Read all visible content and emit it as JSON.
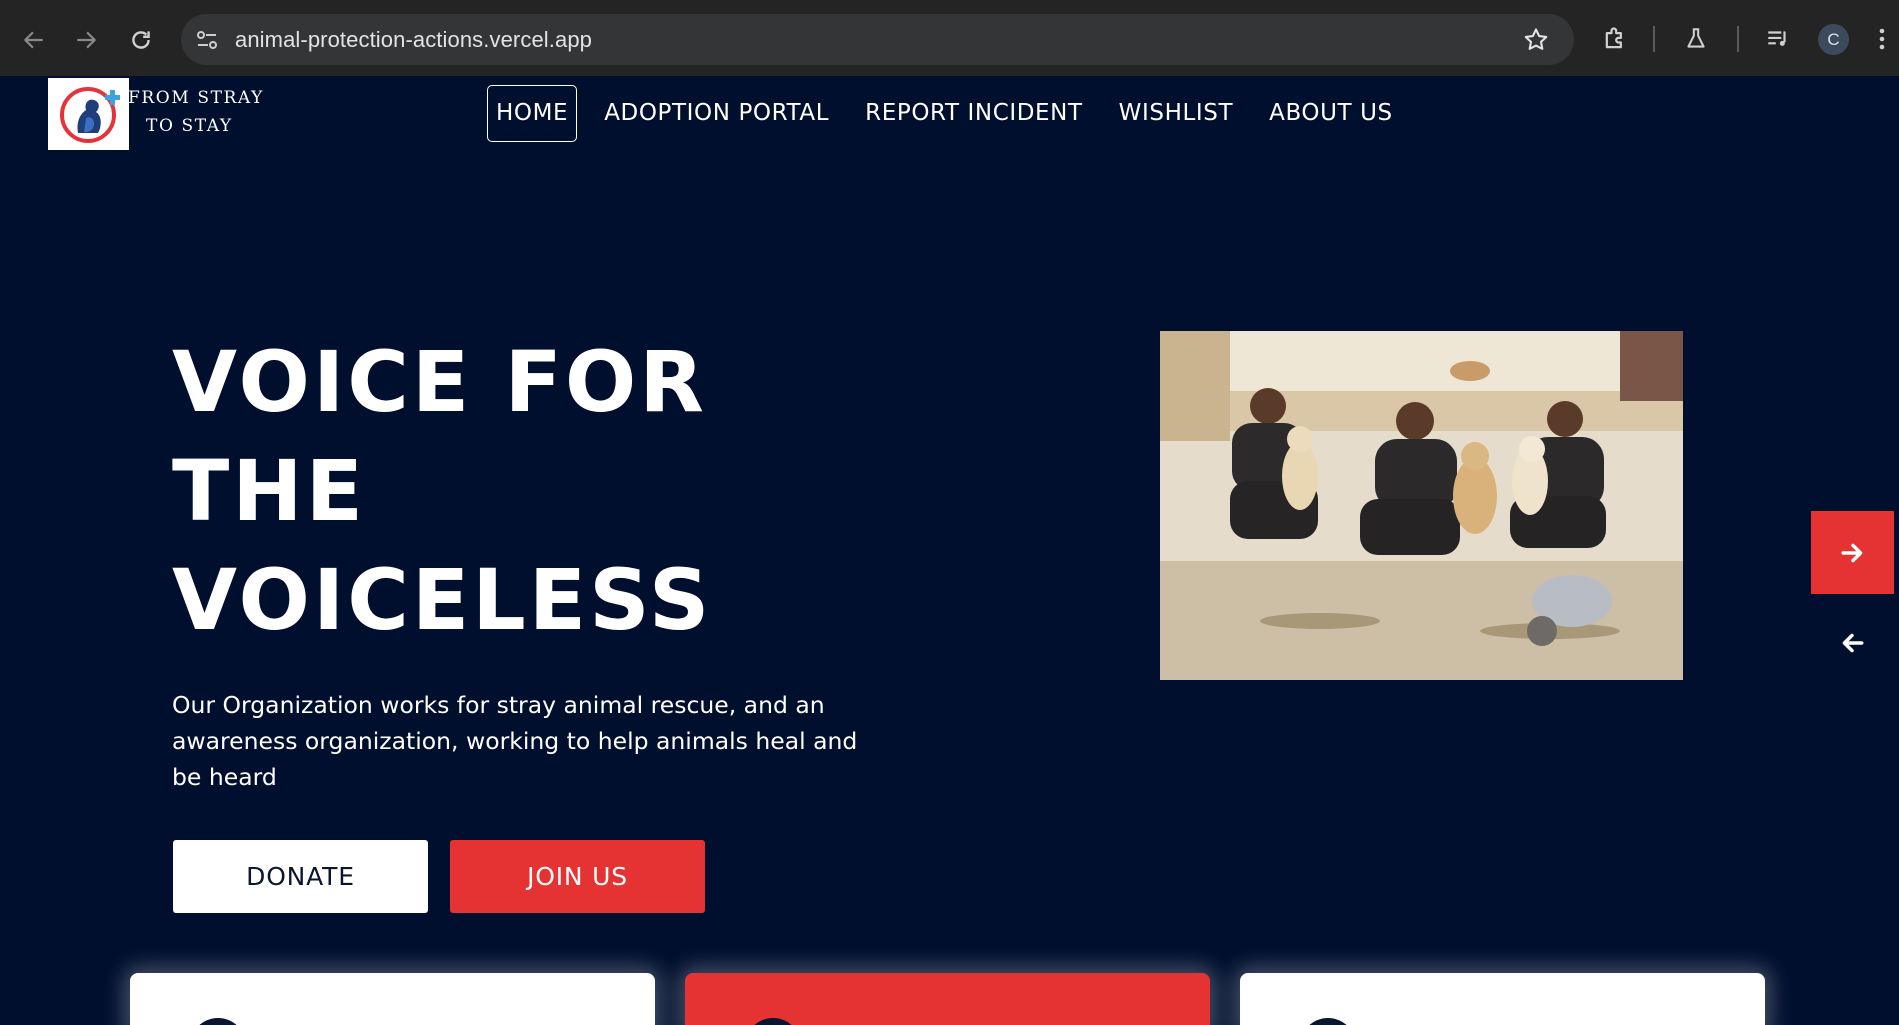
{
  "browser": {
    "url": "animal-protection-actions.vercel.app",
    "profile_initial": "C",
    "icons": [
      "back-arrow-icon",
      "forward-arrow-icon",
      "reload-icon",
      "site-settings-icon",
      "bookmark-star-icon",
      "extensions-icon",
      "labs-flask-icon",
      "media-queue-icon"
    ]
  },
  "site": {
    "logo_line1": "From Stray",
    "logo_line2": "To Stay",
    "nav": [
      {
        "label": "HOME",
        "active": true
      },
      {
        "label": "ADOPTION PORTAL",
        "active": false
      },
      {
        "label": "REPORT INCIDENT",
        "active": false
      },
      {
        "label": "WISHLIST",
        "active": false
      },
      {
        "label": "ABOUT US",
        "active": false
      }
    ]
  },
  "hero": {
    "title_line1": "VOICE FOR",
    "title_line2": "THE",
    "title_line3": "VOICELESS",
    "description": "Our Organization works for stray animal rescue, and an awareness organization, working to help animals heal and be heard",
    "donate_label": "DONATE",
    "join_label": "JOIN US"
  },
  "colors": {
    "page_bg": "#010f2e",
    "accent_red": "#e53333",
    "white": "#ffffff",
    "chrome_bg": "#242424"
  },
  "cards": [
    {
      "color": "#ffffff"
    },
    {
      "color": "#e53333"
    },
    {
      "color": "#ffffff"
    }
  ]
}
